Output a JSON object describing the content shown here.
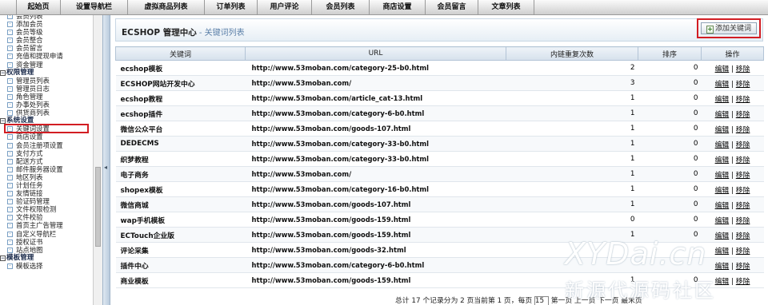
{
  "topnav": {
    "tabs": [
      "起始页",
      "设置导航栏",
      "虚拟商品列表",
      "订单列表",
      "用户评论",
      "会员列表",
      "商店设置",
      "会员留言",
      "文章列表"
    ]
  },
  "sidebar": {
    "items": [
      {
        "type": "item",
        "label": "会员列表"
      },
      {
        "type": "item",
        "label": "添加会员"
      },
      {
        "type": "item",
        "label": "会员等级"
      },
      {
        "type": "item",
        "label": "会员整合"
      },
      {
        "type": "item",
        "label": "会员留言"
      },
      {
        "type": "item",
        "label": "充值和提现申请"
      },
      {
        "type": "item",
        "label": "资金管理"
      },
      {
        "type": "header",
        "label": "权限管理"
      },
      {
        "type": "item",
        "label": "管理员列表"
      },
      {
        "type": "item",
        "label": "管理员日志"
      },
      {
        "type": "item",
        "label": "角色管理"
      },
      {
        "type": "item",
        "label": "办事处列表"
      },
      {
        "type": "item",
        "label": "供货商列表"
      },
      {
        "type": "header",
        "label": "系统设置"
      },
      {
        "type": "item",
        "label": "关键词设置",
        "active": true
      },
      {
        "type": "item",
        "label": "商店设置"
      },
      {
        "type": "item",
        "label": "会员注册项设置"
      },
      {
        "type": "item",
        "label": "支付方式"
      },
      {
        "type": "item",
        "label": "配送方式"
      },
      {
        "type": "item",
        "label": "邮件服务器设置"
      },
      {
        "type": "item",
        "label": "地区列表"
      },
      {
        "type": "item",
        "label": "计划任务"
      },
      {
        "type": "item",
        "label": "友情链接"
      },
      {
        "type": "item",
        "label": "验证码管理"
      },
      {
        "type": "item",
        "label": "文件权限检测"
      },
      {
        "type": "item",
        "label": "文件校验"
      },
      {
        "type": "item",
        "label": "首页主广告管理"
      },
      {
        "type": "item",
        "label": "自定义导航栏"
      },
      {
        "type": "item",
        "label": "授权证书"
      },
      {
        "type": "item",
        "label": "站点地图"
      },
      {
        "type": "header",
        "label": "模板管理"
      },
      {
        "type": "item",
        "label": "模板选择"
      }
    ]
  },
  "header": {
    "title": "ECSHOP 管理中心",
    "subtitle": " - 关键词列表",
    "add_button": "添加关键词"
  },
  "table": {
    "columns": [
      "关键词",
      "URL",
      "内链重复次数",
      "排序",
      "操作"
    ],
    "edit_label": "编辑",
    "sep": " | ",
    "remove_label": "移除",
    "rows": [
      {
        "keyword": "ecshop模板",
        "url": "http://www.53moban.com/category-25-b0.html",
        "repeat": "2",
        "order": "0"
      },
      {
        "keyword": "ECSHOP网站开发中心",
        "url": "http://www.53moban.com/",
        "repeat": "3",
        "order": "0"
      },
      {
        "keyword": "ecshop教程",
        "url": "http://www.53moban.com/article_cat-13.html",
        "repeat": "1",
        "order": "0"
      },
      {
        "keyword": "ecshop插件",
        "url": "http://www.53moban.com/category-6-b0.html",
        "repeat": "1",
        "order": "0"
      },
      {
        "keyword": "微信公众平台",
        "url": "http://www.53moban.com/goods-107.html",
        "repeat": "1",
        "order": "0"
      },
      {
        "keyword": "DEDECMS",
        "url": "http://www.53moban.com/category-33-b0.html",
        "repeat": "1",
        "order": "0"
      },
      {
        "keyword": "织梦教程",
        "url": "http://www.53moban.com/category-33-b0.html",
        "repeat": "1",
        "order": "0"
      },
      {
        "keyword": "电子商务",
        "url": "http://www.53moban.com/",
        "repeat": "1",
        "order": "0"
      },
      {
        "keyword": "shopex模板",
        "url": "http://www.53moban.com/category-16-b0.html",
        "repeat": "1",
        "order": "0"
      },
      {
        "keyword": "微信商城",
        "url": "http://www.53moban.com/goods-107.html",
        "repeat": "1",
        "order": "0"
      },
      {
        "keyword": "wap手机模板",
        "url": "http://www.53moban.com/goods-159.html",
        "repeat": "0",
        "order": "0"
      },
      {
        "keyword": "ECTouch企业版",
        "url": "http://www.53moban.com/goods-159.html",
        "repeat": "1",
        "order": "0"
      },
      {
        "keyword": "评论采集",
        "url": "http://www.53moban.com/goods-32.html",
        "repeat": "",
        "order": ""
      },
      {
        "keyword": "插件中心",
        "url": "http://www.53moban.com/category-6-b0.html",
        "repeat": "",
        "order": ""
      },
      {
        "keyword": "商业模板",
        "url": "http://www.53moban.com/goods-159.html",
        "repeat": "1",
        "order": "0"
      }
    ]
  },
  "pager": {
    "text": "总计 17 个记录分为 2 页当前第 1 页，每页",
    "per_page": "15",
    "links": "第一页 上一页 下一页 最末页"
  },
  "watermark": {
    "line1": "XYDai.cn",
    "line2": "新源代源码社区"
  }
}
